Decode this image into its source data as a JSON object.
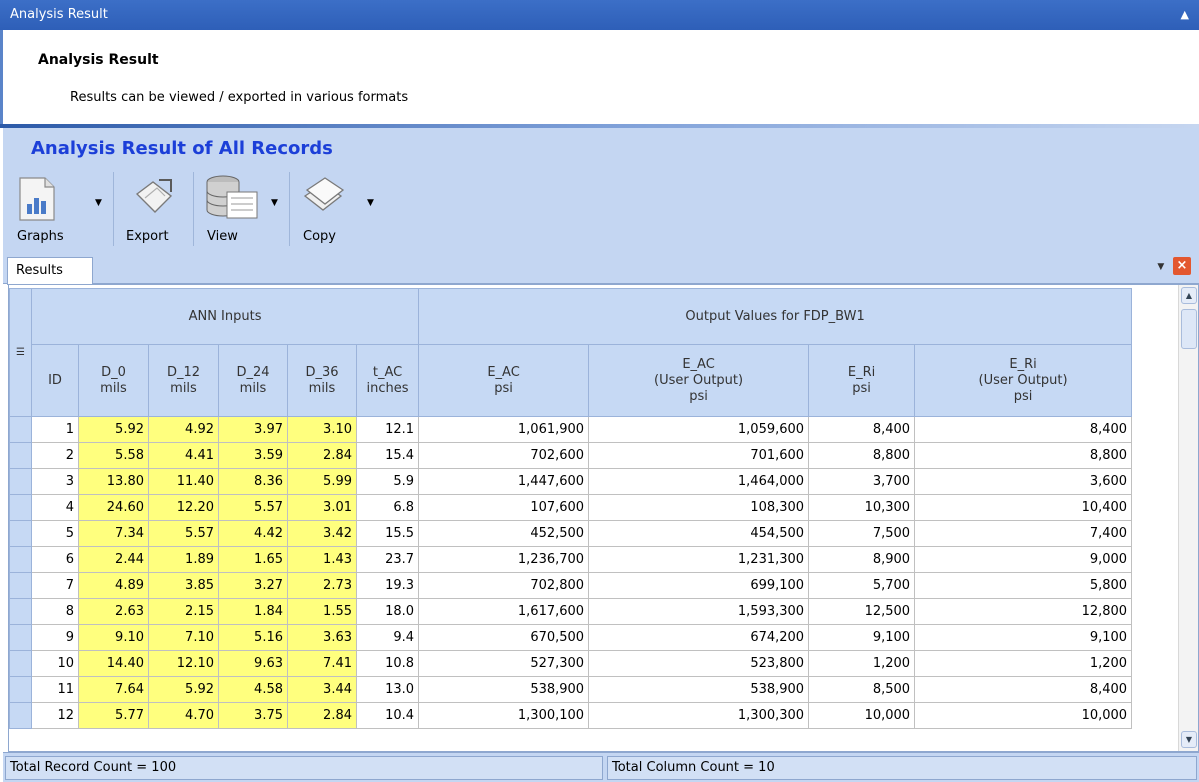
{
  "window": {
    "title": "Analysis Result"
  },
  "header": {
    "title": "Analysis Result",
    "subtitle": "Results can be viewed / exported in various formats"
  },
  "section": {
    "title": "Analysis Result of All Records"
  },
  "toolbar": {
    "graphs_label": "Graphs",
    "export_label": "Export",
    "view_label": "View",
    "copy_label": "Copy"
  },
  "tabs": [
    {
      "label": "Results"
    }
  ],
  "grid": {
    "group_headers": {
      "inputs": "ANN Inputs",
      "outputs": "Output Values for FDP_BW1"
    },
    "columns": [
      {
        "name": "ID",
        "unit": ""
      },
      {
        "name": "D_0",
        "unit": "mils"
      },
      {
        "name": "D_12",
        "unit": "mils"
      },
      {
        "name": "D_24",
        "unit": "mils"
      },
      {
        "name": "D_36",
        "unit": "mils"
      },
      {
        "name": "t_AC",
        "unit": "inches"
      },
      {
        "name": "E_AC",
        "unit": "psi"
      },
      {
        "name": "E_AC",
        "sub": "(User Output)",
        "unit": "psi"
      },
      {
        "name": "E_Ri",
        "unit": "psi"
      },
      {
        "name": "E_Ri",
        "sub": "(User Output)",
        "unit": "psi"
      }
    ],
    "rows": [
      [
        "1",
        "5.92",
        "4.92",
        "3.97",
        "3.10",
        "12.1",
        "1,061,900",
        "1,059,600",
        "8,400",
        "8,400"
      ],
      [
        "2",
        "5.58",
        "4.41",
        "3.59",
        "2.84",
        "15.4",
        "702,600",
        "701,600",
        "8,800",
        "8,800"
      ],
      [
        "3",
        "13.80",
        "11.40",
        "8.36",
        "5.99",
        "5.9",
        "1,447,600",
        "1,464,000",
        "3,700",
        "3,600"
      ],
      [
        "4",
        "24.60",
        "12.20",
        "5.57",
        "3.01",
        "6.8",
        "107,600",
        "108,300",
        "10,300",
        "10,400"
      ],
      [
        "5",
        "7.34",
        "5.57",
        "4.42",
        "3.42",
        "15.5",
        "452,500",
        "454,500",
        "7,500",
        "7,400"
      ],
      [
        "6",
        "2.44",
        "1.89",
        "1.65",
        "1.43",
        "23.7",
        "1,236,700",
        "1,231,300",
        "8,900",
        "9,000"
      ],
      [
        "7",
        "4.89",
        "3.85",
        "3.27",
        "2.73",
        "19.3",
        "702,800",
        "699,100",
        "5,700",
        "5,800"
      ],
      [
        "8",
        "2.63",
        "2.15",
        "1.84",
        "1.55",
        "18.0",
        "1,617,600",
        "1,593,300",
        "12,500",
        "12,800"
      ],
      [
        "9",
        "9.10",
        "7.10",
        "5.16",
        "3.63",
        "9.4",
        "670,500",
        "674,200",
        "9,100",
        "9,100"
      ],
      [
        "10",
        "14.40",
        "12.10",
        "9.63",
        "7.41",
        "10.8",
        "527,300",
        "523,800",
        "1,200",
        "1,200"
      ],
      [
        "11",
        "7.64",
        "5.92",
        "4.58",
        "3.44",
        "13.0",
        "538,900",
        "538,900",
        "8,500",
        "8,400"
      ],
      [
        "12",
        "5.77",
        "4.70",
        "3.75",
        "2.84",
        "10.4",
        "1,300,100",
        "1,300,300",
        "10,000",
        "10,000"
      ]
    ]
  },
  "status": {
    "record_count": "Total Record Count = 100",
    "column_count": "Total Column Count = 10"
  },
  "colors": {
    "title_bar": "#2e5fb8",
    "section_title": "#1c3fd8",
    "toolbar_bg": "#c4d6f2",
    "input_highlight": "#ffff7e",
    "close_button": "#e3572f"
  }
}
